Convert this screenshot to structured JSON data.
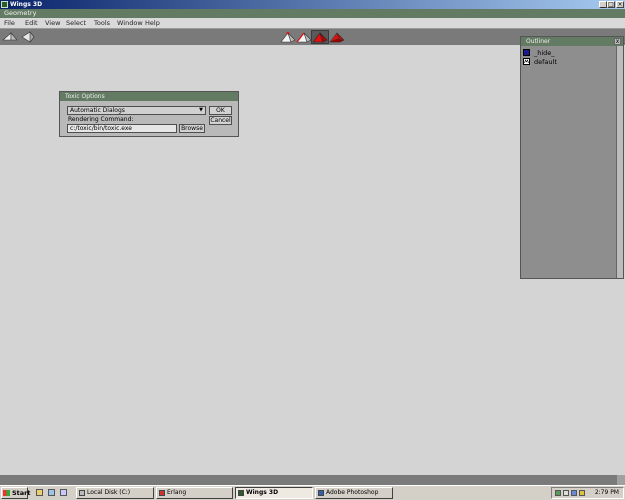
{
  "window": {
    "title": "Wings 3D",
    "controls": {
      "minimize": "_",
      "maximize": "□",
      "close": "×"
    }
  },
  "geometry_bar": {
    "title": "Geometry"
  },
  "menu": {
    "items": [
      {
        "label": "File"
      },
      {
        "label": "Edit"
      },
      {
        "label": "View"
      },
      {
        "label": "Select"
      },
      {
        "label": "Tools"
      },
      {
        "label": "Window"
      },
      {
        "label": "Help"
      }
    ]
  },
  "toolbar": {
    "left_buttons": [
      "undo-icon",
      "redo-icon"
    ],
    "selection_modes": [
      {
        "name": "vertex-mode-icon",
        "selected": false
      },
      {
        "name": "edge-mode-icon",
        "selected": false
      },
      {
        "name": "face-mode-icon",
        "selected": true
      },
      {
        "name": "body-mode-icon",
        "selected": false
      }
    ],
    "accent_red": "#e01010"
  },
  "outliner": {
    "title": "Outliner",
    "close": "x",
    "items": [
      {
        "label": "_hide_",
        "icon": "hide-folder-icon",
        "color": "#1a1a8c"
      },
      {
        "label": "default",
        "icon": "material-icon",
        "color": "#ffffff"
      }
    ]
  },
  "toxic_dialog": {
    "title": "Toxic Options",
    "dialog_select": "Automatic Dialogs",
    "rendering_label": "Rendering Command:",
    "rendering_value": "c:/toxic/bin/toxic.exe",
    "ok_label": "OK",
    "cancel_label": "Cancel",
    "browse_label": "Browse"
  },
  "taskbar": {
    "start_label": "Start",
    "tasks": [
      {
        "label": "Local Disk (C:)",
        "active": false
      },
      {
        "label": "Erlang",
        "active": false
      },
      {
        "label": "Wings 3D",
        "active": true
      },
      {
        "label": "Adobe Photoshop",
        "active": false
      }
    ],
    "clock": "2:79 PM"
  },
  "colors": {
    "panel_green": "#627b62",
    "workspace": "#d4d4d4",
    "toolbar": "#7a7a7a"
  }
}
